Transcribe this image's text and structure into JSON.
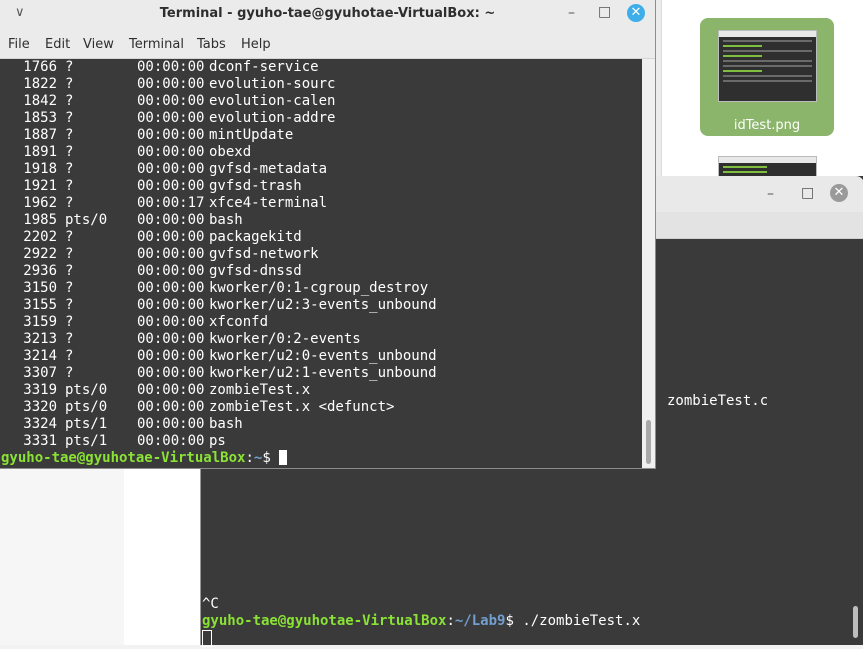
{
  "file_manager": {
    "thumbnail_label": "idTest.png"
  },
  "terminal2": {
    "zombie_file": "zombieTest.c",
    "ctrl_c": "^C",
    "prompt_user": "gyuho-tae@gyuhotae-VirtualBox",
    "prompt_colon": ":",
    "prompt_path": "~/Lab9",
    "prompt_sign": "$",
    "command": " ./zombieTest.x"
  },
  "terminal1": {
    "title": "Terminal - gyuho-tae@gyuhotae-VirtualBox: ~",
    "menu": {
      "file": "File",
      "edit": "Edit",
      "view": "View",
      "terminal": "Terminal",
      "tabs": "Tabs",
      "help": "Help"
    },
    "ps_rows": [
      {
        "pid": "1766",
        "tty": "?",
        "time": "00:00:00",
        "cmd": "dconf-service"
      },
      {
        "pid": "1822",
        "tty": "?",
        "time": "00:00:00",
        "cmd": "evolution-sourc"
      },
      {
        "pid": "1842",
        "tty": "?",
        "time": "00:00:00",
        "cmd": "evolution-calen"
      },
      {
        "pid": "1853",
        "tty": "?",
        "time": "00:00:00",
        "cmd": "evolution-addre"
      },
      {
        "pid": "1887",
        "tty": "?",
        "time": "00:00:00",
        "cmd": "mintUpdate"
      },
      {
        "pid": "1891",
        "tty": "?",
        "time": "00:00:00",
        "cmd": "obexd"
      },
      {
        "pid": "1918",
        "tty": "?",
        "time": "00:00:00",
        "cmd": "gvfsd-metadata"
      },
      {
        "pid": "1921",
        "tty": "?",
        "time": "00:00:00",
        "cmd": "gvfsd-trash"
      },
      {
        "pid": "1962",
        "tty": "?",
        "time": "00:00:17",
        "cmd": "xfce4-terminal"
      },
      {
        "pid": "1985",
        "tty": "pts/0",
        "time": "00:00:00",
        "cmd": "bash"
      },
      {
        "pid": "2202",
        "tty": "?",
        "time": "00:00:00",
        "cmd": "packagekitd"
      },
      {
        "pid": "2922",
        "tty": "?",
        "time": "00:00:00",
        "cmd": "gvfsd-network"
      },
      {
        "pid": "2936",
        "tty": "?",
        "time": "00:00:00",
        "cmd": "gvfsd-dnssd"
      },
      {
        "pid": "3150",
        "tty": "?",
        "time": "00:00:00",
        "cmd": "kworker/0:1-cgroup_destroy"
      },
      {
        "pid": "3155",
        "tty": "?",
        "time": "00:00:00",
        "cmd": "kworker/u2:3-events_unbound"
      },
      {
        "pid": "3159",
        "tty": "?",
        "time": "00:00:00",
        "cmd": "xfconfd"
      },
      {
        "pid": "3213",
        "tty": "?",
        "time": "00:00:00",
        "cmd": "kworker/0:2-events"
      },
      {
        "pid": "3214",
        "tty": "?",
        "time": "00:00:00",
        "cmd": "kworker/u2:0-events_unbound"
      },
      {
        "pid": "3307",
        "tty": "?",
        "time": "00:00:00",
        "cmd": "kworker/u2:1-events_unbound"
      },
      {
        "pid": "3319",
        "tty": "pts/0",
        "time": "00:00:00",
        "cmd": "zombieTest.x"
      },
      {
        "pid": "3320",
        "tty": "pts/0",
        "time": "00:00:00",
        "cmd": "zombieTest.x <defunct>"
      },
      {
        "pid": "3324",
        "tty": "pts/1",
        "time": "00:00:00",
        "cmd": "bash"
      },
      {
        "pid": "3331",
        "tty": "pts/1",
        "time": "00:00:00",
        "cmd": "ps"
      }
    ],
    "prompt_user": "gyuho-tae@gyuhotae-VirtualBox",
    "prompt_colon": ":",
    "prompt_path": "~",
    "prompt_sign": "$"
  }
}
